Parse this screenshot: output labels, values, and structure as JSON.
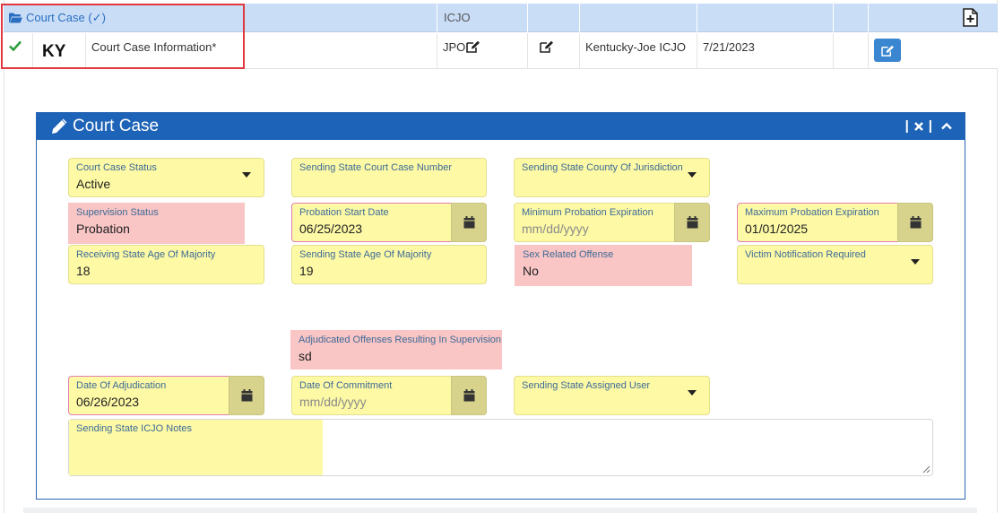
{
  "header_row": {
    "link_label": "Court Case (✓)",
    "col_text": "ICJO"
  },
  "data_row": {
    "state": "KY",
    "description": "Court Case Information*",
    "role": "JPO",
    "agency": "Kentucky-Joe ICJO",
    "date": "7/21/2023"
  },
  "panel": {
    "title": "Court Case",
    "tools_separator": "|"
  },
  "form": {
    "court_case_status": {
      "label": "Court Case Status",
      "value": "Active"
    },
    "sending_case_number": {
      "label": "Sending State Court Case Number",
      "value": ""
    },
    "sending_county": {
      "label": "Sending State County Of Jurisdiction",
      "value": ""
    },
    "supervision_status": {
      "label": "Supervision Status",
      "value": "Probation"
    },
    "probation_start": {
      "label": "Probation Start Date",
      "value": "06/25/2023"
    },
    "min_probation_exp": {
      "label": "Minimum Probation Expiration",
      "placeholder": "mm/dd/yyyy"
    },
    "max_probation_exp": {
      "label": "Maximum Probation Expiration",
      "value": "01/01/2025"
    },
    "receiving_age": {
      "label": "Receiving State Age Of Majority",
      "value": "18"
    },
    "sending_age": {
      "label": "Sending State Age Of Majority",
      "value": "19"
    },
    "sex_offense": {
      "label": "Sex Related Offense",
      "value": "No"
    },
    "victim_notification": {
      "label": "Victim Notification Required",
      "value": ""
    },
    "adjudicated_offenses": {
      "label": "Adjudicated Offenses Resulting In Supervision",
      "value": "sd"
    },
    "date_adjudication": {
      "label": "Date Of Adjudication",
      "value": "06/26/2023"
    },
    "date_commitment": {
      "label": "Date Of Commitment",
      "placeholder": "mm/dd/yyyy"
    },
    "assigned_user": {
      "label": "Sending State Assigned User",
      "value": ""
    },
    "icjo_notes": {
      "label": "Sending State ICJO Notes",
      "value": ""
    }
  },
  "colors": {
    "accent": "#1d63b7",
    "field_yellow": "#fdf9a5",
    "field_required": "#f9c5c5",
    "header_row": "#c9ddf7",
    "highlight_border": "#e0383e",
    "check_green": "#2e9e3f"
  }
}
